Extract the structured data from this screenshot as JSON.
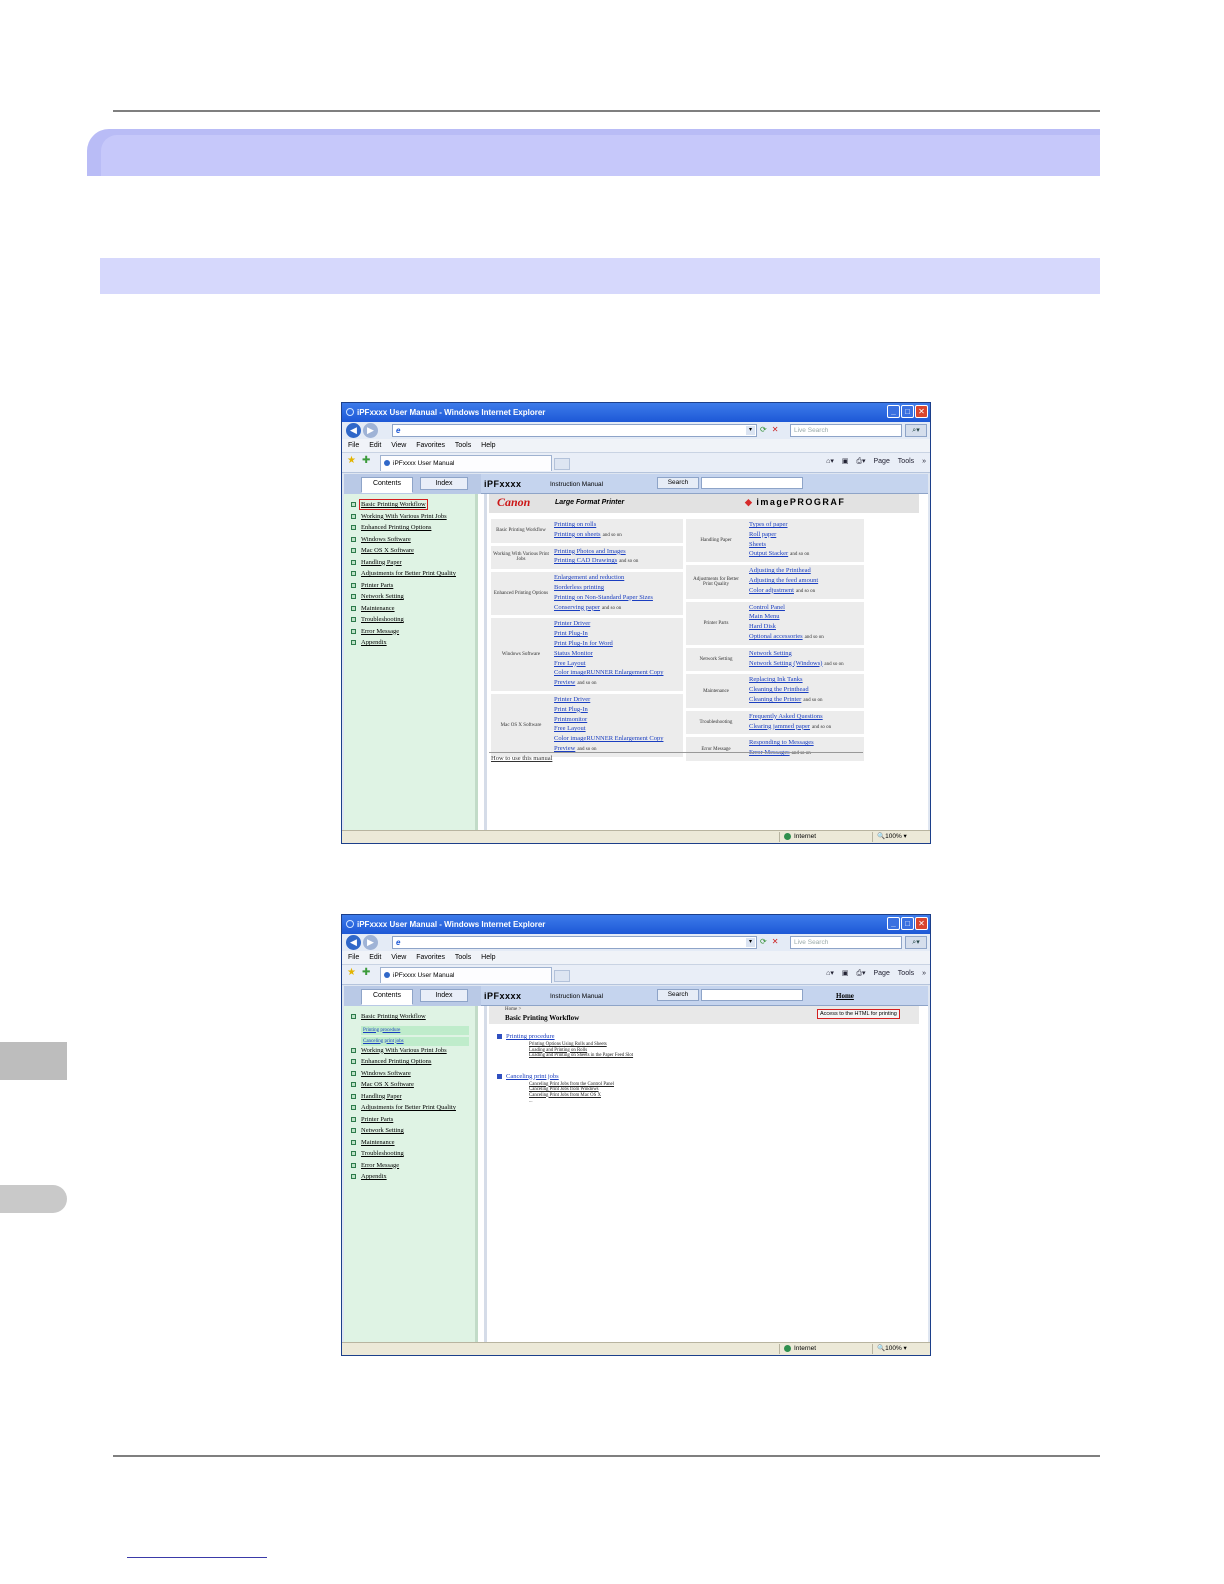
{
  "window_title": "iPFxxxx User Manual - Windows Internet Explorer",
  "search_placeholder": "Live Search",
  "menu": [
    "File",
    "Edit",
    "View",
    "Favorites",
    "Tools",
    "Help"
  ],
  "tab_title": "iPFxxxx User Manual",
  "command_bar": {
    "page": "Page",
    "tools": "Tools",
    "more": "»"
  },
  "tabs": {
    "contents": "Contents",
    "index": "Index"
  },
  "header": {
    "brand": "iPFxxxx",
    "subtitle": "Instruction Manual",
    "search": "Search",
    "home": "Home"
  },
  "status": {
    "zone": "Internet",
    "zoom": "100%"
  },
  "sidebar_items": [
    "Basic Printing Workflow",
    "Working With Various Print Jobs",
    "Enhanced Printing Options",
    "Windows Software",
    "Mac OS X Software",
    "Handling Paper",
    "Adjustments for Better Print Quality",
    "Printer Parts",
    "Network Setting",
    "Maintenance",
    "Troubleshooting",
    "Error Message",
    "Appendix"
  ],
  "sidebar_subitems": [
    "Printing procedure",
    "Canceling print jobs"
  ],
  "page1": {
    "canon": "Canon",
    "large_format": "Large Format Printer",
    "imageprograf": "imagePROGRAF",
    "left_categories": [
      {
        "name": "Basic Printing Workflow",
        "links": [
          "Printing on rolls",
          "Printing on sheets"
        ]
      },
      {
        "name": "Working With Various Print Jobs",
        "links": [
          "Printing Photos and Images",
          "Printing CAD Drawings"
        ]
      },
      {
        "name": "Enhanced Printing Options",
        "links": [
          "Enlargement and reduction",
          "Borderless printing",
          "Printing on Non-Standard Paper Sizes",
          "Conserving paper"
        ]
      },
      {
        "name": "Windows Software",
        "links": [
          "Printer Driver",
          "Print Plug-In",
          "Print Plug-In for Word",
          "Status Monitor",
          "Free Layout",
          "Color imageRUNNER Enlargement Copy",
          "Preview"
        ]
      },
      {
        "name": "Mac OS X Software",
        "links": [
          "Printer Driver",
          "Print Plug-In",
          "Printmonitor",
          "Free Layout",
          "Color imageRUNNER Enlargement Copy",
          "Preview"
        ]
      }
    ],
    "right_categories": [
      {
        "name": "Handling Paper",
        "links": [
          "Types of paper",
          "Roll paper",
          "Sheets",
          "Output Stacker"
        ]
      },
      {
        "name": "Adjustments for Better Print Quality",
        "links": [
          "Adjusting the Printhead",
          "Adjusting the feed amount",
          "Color adjustment"
        ]
      },
      {
        "name": "Printer Parts",
        "links": [
          "Control Panel",
          "Main Menu",
          "Hard Disk",
          "Optional accessories"
        ]
      },
      {
        "name": "Network Setting",
        "links": [
          "Network Setting",
          "Network Setting (Windows)"
        ]
      },
      {
        "name": "Maintenance",
        "links": [
          "Replacing Ink Tanks",
          "Cleaning the Printhead",
          "Cleaning the Printer"
        ]
      },
      {
        "name": "Troubleshooting",
        "links": [
          "Frequently Asked Questions",
          "Clearing jammed paper"
        ]
      },
      {
        "name": "Error Message",
        "links": [
          "Responding to Messages",
          "Error Messages"
        ]
      }
    ],
    "how_to": "How to use this manual"
  },
  "page2": {
    "breadcrumb": "Home >",
    "heading": "Basic Printing Workflow",
    "access_button": "Access to the HTML for printing",
    "sections": [
      {
        "title": "Printing procedure",
        "items": [
          "Printing Options Using Rolls and Sheets",
          "Loading and Printing on Rolls",
          "Loading and Printing on Sheets in the Paper Feed Slot"
        ]
      },
      {
        "title": "Canceling print jobs",
        "items": [
          "Canceling Print Jobs from the Control Panel",
          "Canceling Print Jobs from Windows",
          "Canceling Print Jobs from Mac OS X"
        ]
      }
    ],
    "ellipsis": "..."
  }
}
